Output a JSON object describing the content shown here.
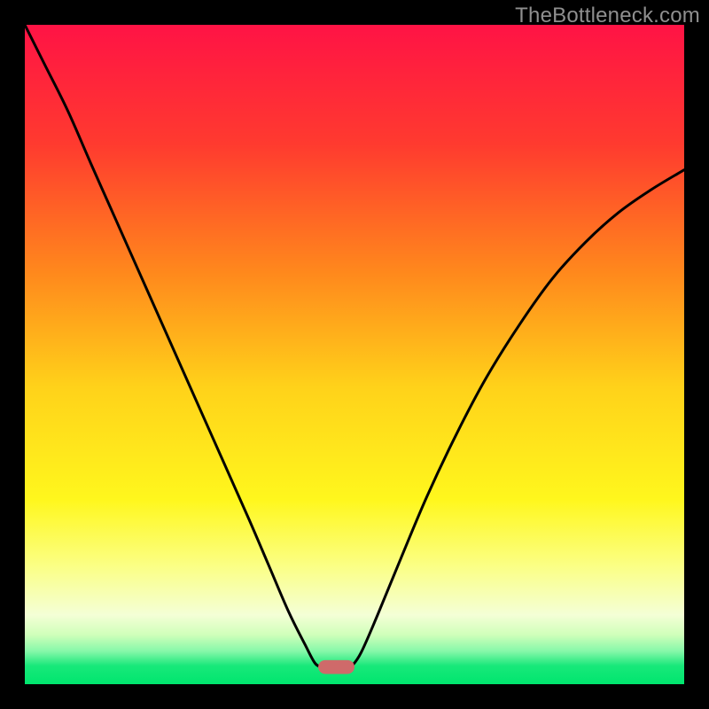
{
  "watermark": "TheBottleneck.com",
  "chart_data": {
    "type": "line",
    "title": "",
    "xlabel": "",
    "ylabel": "",
    "xlim": [
      0,
      100
    ],
    "ylim": [
      0,
      100
    ],
    "grid": false,
    "legend": false,
    "annotations": [],
    "background_gradient_stops": [
      {
        "pos": 0.0,
        "color": "#ff1345"
      },
      {
        "pos": 0.18,
        "color": "#ff3a2f"
      },
      {
        "pos": 0.38,
        "color": "#ff8a1c"
      },
      {
        "pos": 0.55,
        "color": "#ffd21a"
      },
      {
        "pos": 0.72,
        "color": "#fff71d"
      },
      {
        "pos": 0.82,
        "color": "#fbff84"
      },
      {
        "pos": 0.895,
        "color": "#f4ffd6"
      },
      {
        "pos": 0.925,
        "color": "#d0ffba"
      },
      {
        "pos": 0.95,
        "color": "#86f8a9"
      },
      {
        "pos": 0.972,
        "color": "#18e87a"
      },
      {
        "pos": 1.0,
        "color": "#00e66e"
      }
    ],
    "series": [
      {
        "name": "left-curve",
        "x": [
          0.0,
          3.0,
          6.5,
          10.0,
          14.0,
          18.0,
          22.0,
          26.0,
          30.0,
          34.0,
          37.0,
          40.0,
          42.5,
          44.0,
          45.0
        ],
        "y": [
          100.0,
          94.0,
          87.0,
          79.0,
          70.0,
          61.0,
          52.0,
          43.0,
          34.0,
          25.0,
          18.0,
          11.0,
          6.0,
          3.2,
          2.6
        ]
      },
      {
        "name": "right-curve",
        "x": [
          49.5,
          51.0,
          53.5,
          57.0,
          61.0,
          65.5,
          70.0,
          75.0,
          80.0,
          85.0,
          90.0,
          95.0,
          100.0
        ],
        "y": [
          2.6,
          4.8,
          10.5,
          19.0,
          28.5,
          38.0,
          46.5,
          54.5,
          61.5,
          67.0,
          71.5,
          75.0,
          78.0
        ]
      }
    ],
    "marker": {
      "name": "optimum-marker",
      "x0": 44.5,
      "x1": 50.0,
      "y": 2.6,
      "height": 2.1,
      "color": "#cf6a6a"
    }
  }
}
